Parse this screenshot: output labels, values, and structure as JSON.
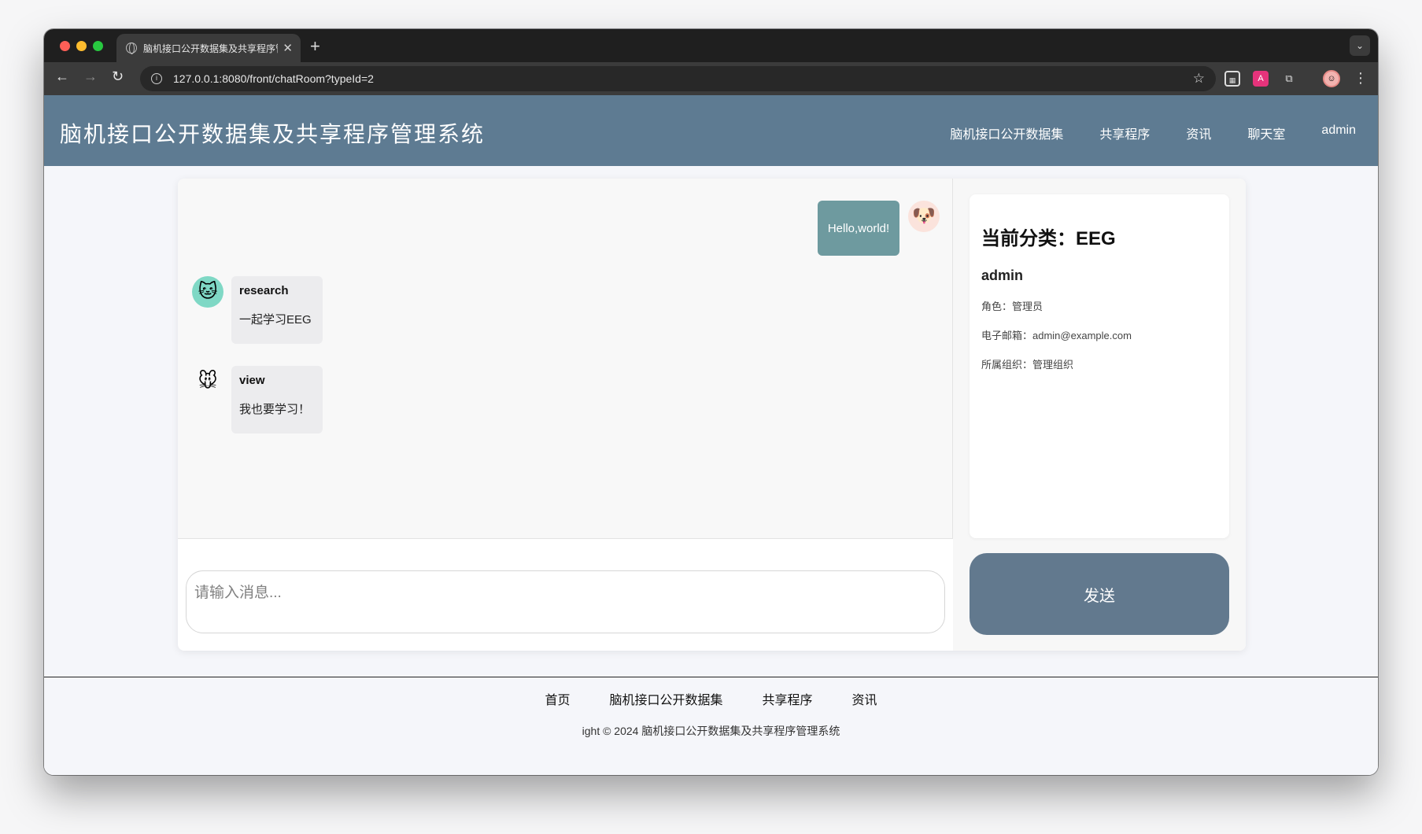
{
  "browser": {
    "tab_title": "脑机接口公开数据集及共享程序管理系统",
    "new_tab_label": "+",
    "url": "127.0.0.1:8080/front/chatRoom?typeId=2",
    "icons": [
      "back-icon",
      "forward-icon",
      "reload-icon",
      "info-icon",
      "star-icon",
      "qr-extension-icon",
      "translate-extension-icon",
      "puzzle-extension-icon",
      "profile-avatar",
      "kebab-menu-icon"
    ]
  },
  "header": {
    "title": "脑机接口公开数据集及共享程序管理系统",
    "nav": [
      "脑机接口公开数据集",
      "共享程序",
      "资讯",
      "聊天室",
      "admin"
    ]
  },
  "chat": {
    "messages": [
      {
        "side": "right",
        "text": "Hello,world!",
        "avatar": "dog-avatar"
      },
      {
        "side": "left",
        "sender": "research",
        "text": "一起学习EEG",
        "avatar": "cat-avatar"
      },
      {
        "side": "left",
        "sender": "view",
        "text": "我也要学习！",
        "avatar": "mouse-avatar"
      }
    ],
    "input_placeholder": "请输入消息...",
    "send_label": "发送"
  },
  "panel": {
    "category_title": "当前分类：EEG",
    "username": "admin",
    "role": "角色：管理员",
    "email": "电子邮箱：admin@example.com",
    "org": "所属组织：管理组织"
  },
  "footer": {
    "nav": [
      "首页",
      "脑机接口公开数据集",
      "共享程序",
      "资讯"
    ],
    "copyright": "ight © 2024 脑机接口公开数据集及共享程序管理系统"
  },
  "colors": {
    "header_bg": "#5e7b92",
    "my_bubble": "#6e9a9f",
    "send_button": "#62798e"
  }
}
